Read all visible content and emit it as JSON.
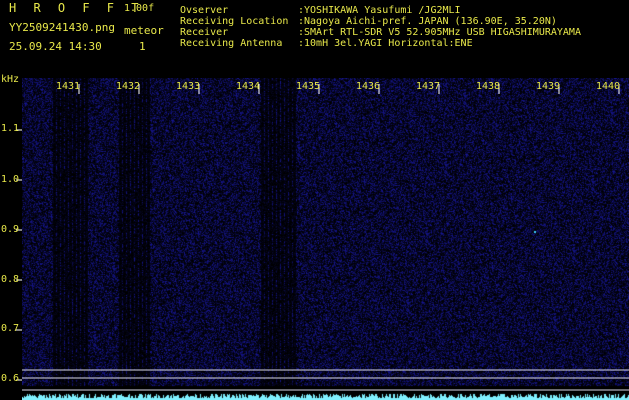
{
  "header": {
    "app_title": "H R O F F T",
    "app_version": "1.00f",
    "filename": "YY2509241430.png",
    "detection_type": "meteor",
    "timestamp": "25.09.24 14:30",
    "count": "1"
  },
  "info": [
    {
      "key": "Ovserver",
      "value": ":YOSHIKAWA Yasufumi /JG2MLI"
    },
    {
      "key": "Receiving Location",
      "value": ":Nagoya Aichi-pref. JAPAN (136.90E, 35.20N)"
    },
    {
      "key": "Receiver",
      "value": ":SMArt RTL-SDR V5 52.905MHz USB HIGASHIMURAYAMA"
    },
    {
      "key": "Receiving Antenna",
      "value": ":10mH 3el.YAGI Horizontal:ENE"
    }
  ],
  "axes": {
    "y_unit": "kHz",
    "y_ticks": [
      "1.1",
      "1.0",
      "0.9",
      "0.8",
      "0.7",
      "0.6"
    ],
    "x_ticks": [
      "1431",
      "1432",
      "1433",
      "1434",
      "1435",
      "1436",
      "1437",
      "1438",
      "1439",
      "1440"
    ]
  },
  "colors": {
    "background": "#000000",
    "label": "#e8e84a",
    "text_green": "#9fef60",
    "noise": "#1a1aa0",
    "signal": "#3fd0ff",
    "level": "#7ff0ff"
  }
}
